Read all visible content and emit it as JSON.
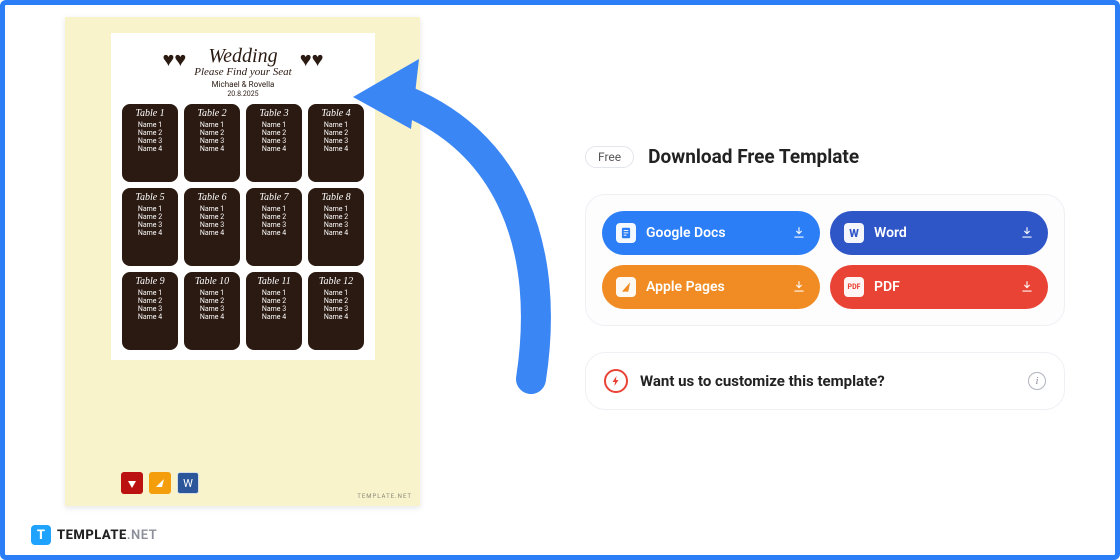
{
  "card": {
    "title1": "Wedding",
    "title2": "Please Find your Seat",
    "couple": "Michael & Rovella",
    "date": "20.8.2025",
    "tables": [
      {
        "title": "Table 1",
        "names": [
          "Name 1",
          "Name 2",
          "Name 3",
          "Name 4"
        ]
      },
      {
        "title": "Table 2",
        "names": [
          "Name 1",
          "Name 2",
          "Name 3",
          "Name 4"
        ]
      },
      {
        "title": "Table 3",
        "names": [
          "Name 1",
          "Name 2",
          "Name 3",
          "Name 4"
        ]
      },
      {
        "title": "Table 4",
        "names": [
          "Name 1",
          "Name 2",
          "Name 3",
          "Name 4"
        ]
      },
      {
        "title": "Table 5",
        "names": [
          "Name 1",
          "Name 2",
          "Name 3",
          "Name 4"
        ]
      },
      {
        "title": "Table 6",
        "names": [
          "Name 1",
          "Name 2",
          "Name 3",
          "Name 4"
        ]
      },
      {
        "title": "Table 7",
        "names": [
          "Name 1",
          "Name 2",
          "Name 3",
          "Name 4"
        ]
      },
      {
        "title": "Table 8",
        "names": [
          "Name 1",
          "Name 2",
          "Name 3",
          "Name 4"
        ]
      },
      {
        "title": "Table 9",
        "names": [
          "Name 1",
          "Name 2",
          "Name 3",
          "Name 4"
        ]
      },
      {
        "title": "Table 10",
        "names": [
          "Name 1",
          "Name 2",
          "Name 3",
          "Name 4"
        ]
      },
      {
        "title": "Table 11",
        "names": [
          "Name 1",
          "Name 2",
          "Name 3",
          "Name 4"
        ]
      },
      {
        "title": "Table 12",
        "names": [
          "Name 1",
          "Name 2",
          "Name 3",
          "Name 4"
        ]
      }
    ],
    "watermark": "TEMPLATE.NET"
  },
  "header": {
    "free_chip": "Free",
    "title": "Download Free Template"
  },
  "buttons": {
    "gdoc": "Google Docs",
    "word": "Word",
    "pages": "Apple Pages",
    "pdf": "PDF"
  },
  "customize": {
    "text": "Want us to customize this template?"
  },
  "footer": {
    "brand": "TEMPLATE",
    "suffix": ".NET"
  }
}
